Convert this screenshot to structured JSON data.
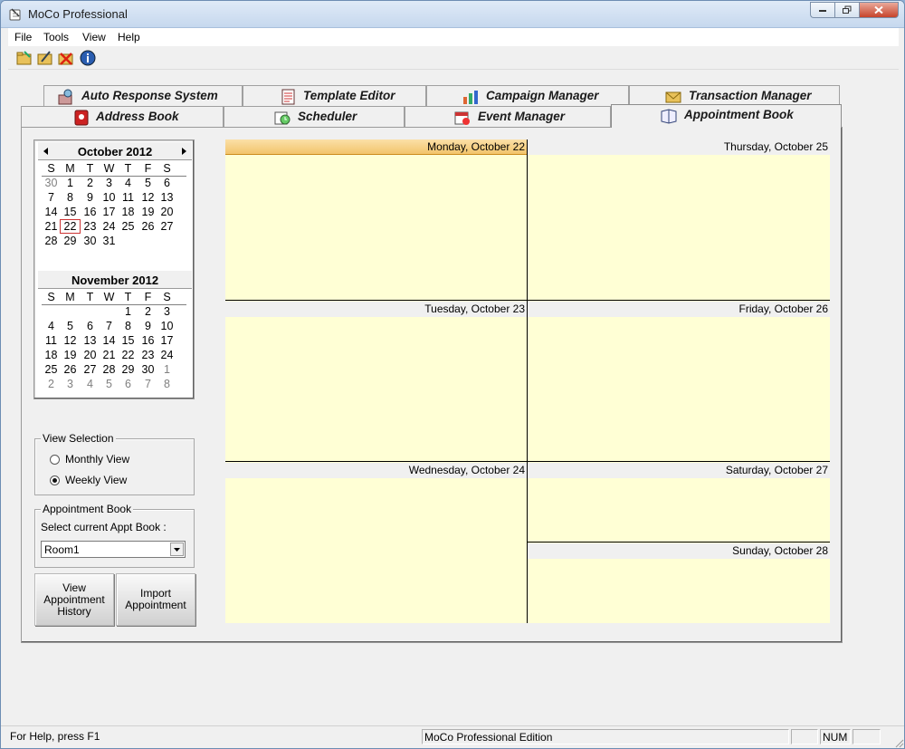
{
  "window": {
    "title": "MoCo Professional"
  },
  "menu": {
    "items": [
      "File",
      "Tools",
      "View",
      "Help"
    ]
  },
  "toolbar": {
    "icons": [
      "open-folder-icon",
      "edit-folder-icon",
      "delete-icon",
      "info-icon"
    ]
  },
  "tabs": {
    "top_row": [
      "Auto Response System",
      "Template Editor",
      "Campaign Manager",
      "Transaction Manager"
    ],
    "bottom_row": [
      "Address Book",
      "Scheduler",
      "Event Manager",
      "Appointment Book"
    ],
    "active": "Appointment Book"
  },
  "calendar": {
    "weekday_headers": [
      "S",
      "M",
      "T",
      "W",
      "T",
      "F",
      "S"
    ],
    "month1": {
      "title": "October 2012",
      "weeks": [
        [
          "30",
          "1",
          "2",
          "3",
          "4",
          "5",
          "6"
        ],
        [
          "7",
          "8",
          "9",
          "10",
          "11",
          "12",
          "13"
        ],
        [
          "14",
          "15",
          "16",
          "17",
          "18",
          "19",
          "20"
        ],
        [
          "21",
          "22",
          "23",
          "24",
          "25",
          "26",
          "27"
        ],
        [
          "28",
          "29",
          "30",
          "31",
          "",
          "",
          ""
        ]
      ]
    },
    "month2": {
      "title": "November 2012",
      "weeks": [
        [
          "",
          "",
          "",
          "",
          "1",
          "2",
          "3"
        ],
        [
          "4",
          "5",
          "6",
          "7",
          "8",
          "9",
          "10"
        ],
        [
          "11",
          "12",
          "13",
          "14",
          "15",
          "16",
          "17"
        ],
        [
          "18",
          "19",
          "20",
          "21",
          "22",
          "23",
          "24"
        ],
        [
          "25",
          "26",
          "27",
          "28",
          "29",
          "30",
          "1"
        ],
        [
          "2",
          "3",
          "4",
          "5",
          "6",
          "7",
          "8"
        ]
      ]
    }
  },
  "view_selection": {
    "legend": "View Selection",
    "monthly_label": "Monthly View",
    "weekly_label": "Weekly View",
    "selected": "weekly"
  },
  "appointment_book": {
    "legend": "Appointment Book",
    "select_label": "Select current Appt Book :",
    "selected_value": "Room1"
  },
  "buttons": {
    "view_history": "View Appointment History",
    "import": "Import Appointment"
  },
  "week_view": {
    "days": [
      "Monday, October 22",
      "Tuesday, October 23",
      "Wednesday, October 24",
      "Thursday, October 25",
      "Friday, October 26",
      "Saturday, October 27",
      "Sunday, October 28"
    ],
    "selected_day": "Monday, October 22"
  },
  "statusbar": {
    "help": "For Help, press F1",
    "edition": "MoCo Professional Edition",
    "num": "NUM"
  }
}
